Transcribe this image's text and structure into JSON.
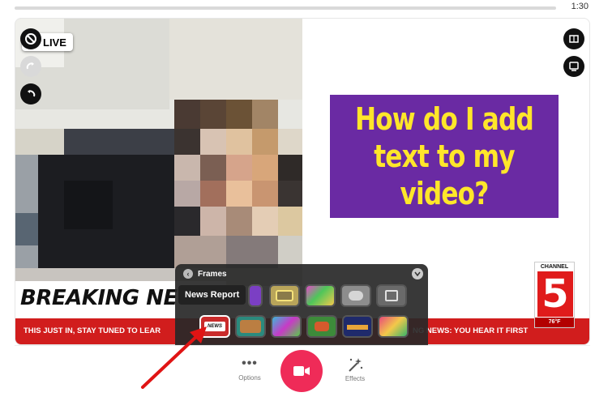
{
  "timer": "1:30",
  "live_badge": "LIVE",
  "overlay": {
    "title_text": "How do I add text to my video?",
    "breaking_text": "BREAKING NE",
    "ticker_left": "THIS JUST IN, STAY TUNED TO LEAR",
    "ticker_right": "NG NEWS: YOU HEAR IT FIRST",
    "channel": {
      "label": "CHANNEL",
      "number": "5",
      "temp": "76°F"
    }
  },
  "frames_panel": {
    "title": "Frames",
    "tooltip": "News Report",
    "selected_thumb_label": "NEWS"
  },
  "toolbar": {
    "options_label": "Options",
    "effects_label": "Effects"
  },
  "colors": {
    "record": "#ef2b58",
    "title_bg": "#6a2aa3",
    "title_text": "#ffe62a",
    "ticker": "#d11d1d",
    "annotation_arrow": "#e01414"
  },
  "icons": [
    "no-sign-icon",
    "redo-icon",
    "undo-icon",
    "book-icon",
    "screen-icon",
    "chevron-left-icon",
    "chevron-down-icon",
    "more-dots-icon",
    "video-camera-icon",
    "magic-wand-icon"
  ]
}
